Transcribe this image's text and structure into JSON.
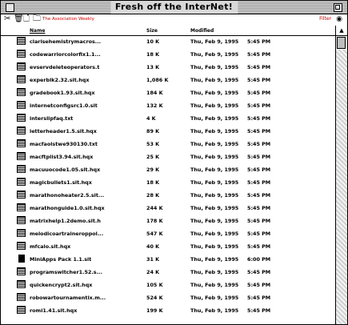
{
  "window": {
    "title": "Fresh off the InterNet!",
    "path_label": "The Association Weekly",
    "filter_label": "Filter"
  },
  "header": {
    "name": "Name",
    "size": "Size",
    "modified": "Modified"
  },
  "colors": {
    "accent": "#cc0000"
  },
  "icons": {
    "close": "close-box",
    "zoom": "zoom-box",
    "file": "document-icon",
    "app": "application-icon"
  },
  "files": [
    {
      "name": "clarisehemistrymacros...",
      "size": "10 K",
      "date": "Thu, Feb 9, 1995",
      "time": "5:45 PM",
      "kind": "doc"
    },
    {
      "name": "codewarriorcolorfix1.1...",
      "size": "18 K",
      "date": "Thu, Feb 9, 1995",
      "time": "5:45 PM",
      "kind": "doc"
    },
    {
      "name": "evservdeleteoperators.t",
      "size": "13 K",
      "date": "Thu, Feb 9, 1995",
      "time": "5:45 PM",
      "kind": "doc"
    },
    {
      "name": "experblk2.32.sit.hqx",
      "size": "1,086 K",
      "date": "Thu, Feb 9, 1995",
      "time": "5:45 PM",
      "kind": "doc"
    },
    {
      "name": "gradebook1.93.sit.hqx",
      "size": "184 K",
      "date": "Thu, Feb 9, 1995",
      "time": "5:45 PM",
      "kind": "doc"
    },
    {
      "name": "internetconfigsrc1.0.sit",
      "size": "132 K",
      "date": "Thu, Feb 9, 1995",
      "time": "5:45 PM",
      "kind": "doc"
    },
    {
      "name": "interslipfaq.txt",
      "size": "4 K",
      "date": "Thu, Feb 9, 1995",
      "time": "5:45 PM",
      "kind": "doc"
    },
    {
      "name": "letterheader1.5.sit.hqx",
      "size": "89 K",
      "date": "Thu, Feb 9, 1995",
      "time": "5:45 PM",
      "kind": "doc"
    },
    {
      "name": "macfaolstwe930130.txt",
      "size": "53 K",
      "date": "Thu, Feb 9, 1995",
      "time": "5:45 PM",
      "kind": "doc"
    },
    {
      "name": "macftplist3.94.sit.hqx",
      "size": "25 K",
      "date": "Thu, Feb 9, 1995",
      "time": "5:45 PM",
      "kind": "doc"
    },
    {
      "name": "macuuocode1.05.sit.hqx",
      "size": "29 K",
      "date": "Thu, Feb 9, 1995",
      "time": "5:45 PM",
      "kind": "doc"
    },
    {
      "name": "magicbullets1.sit.hqx",
      "size": "18 K",
      "date": "Thu, Feb 9, 1995",
      "time": "5:45 PM",
      "kind": "doc"
    },
    {
      "name": "marathonoheater2.5.sit...",
      "size": "28 K",
      "date": "Thu, Feb 9, 1995",
      "time": "5:45 PM",
      "kind": "doc"
    },
    {
      "name": "marathonguide1.0.sit.hqx",
      "size": "244 K",
      "date": "Thu, Feb 9, 1995",
      "time": "5:45 PM",
      "kind": "doc"
    },
    {
      "name": "matrixhelp1.2demo.sit.h",
      "size": "178 K",
      "date": "Thu, Feb 9, 1995",
      "time": "5:45 PM",
      "kind": "doc"
    },
    {
      "name": "melodicoartraineroppol...",
      "size": "547 K",
      "date": "Thu, Feb 9, 1995",
      "time": "5:45 PM",
      "kind": "doc"
    },
    {
      "name": "mfcalo.sit.hqx",
      "size": "40 K",
      "date": "Thu, Feb 9, 1995",
      "time": "5:45 PM",
      "kind": "doc"
    },
    {
      "name": "MiniApps Pack 1.1.sit",
      "size": "31 K",
      "date": "Thu, Feb 9, 1995",
      "time": "6:00 PM",
      "kind": "app"
    },
    {
      "name": "programswitcher1.52.s...",
      "size": "24 K",
      "date": "Thu, Feb 9, 1995",
      "time": "5:45 PM",
      "kind": "doc"
    },
    {
      "name": "quickencrypt2.sit.hqx",
      "size": "105 K",
      "date": "Thu, Feb 9, 1995",
      "time": "5:45 PM",
      "kind": "doc"
    },
    {
      "name": "robowartournamentix.m...",
      "size": "524 K",
      "date": "Thu, Feb 9, 1995",
      "time": "5:45 PM",
      "kind": "doc"
    },
    {
      "name": "romi1.41.sit.hqx",
      "size": "199 K",
      "date": "Thu, Feb 9, 1995",
      "time": "5:45 PM",
      "kind": "doc"
    }
  ]
}
